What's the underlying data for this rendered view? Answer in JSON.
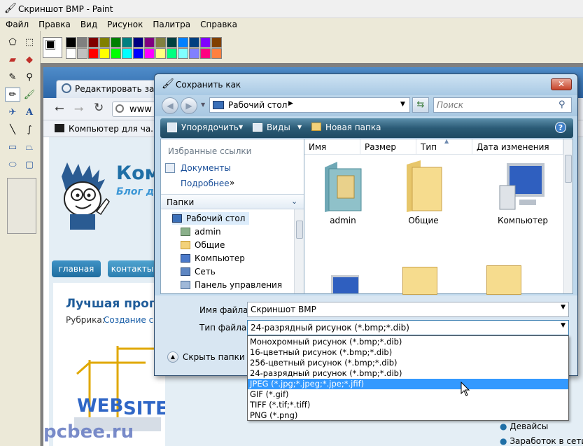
{
  "paint": {
    "title": "Скриншот BMP - Paint",
    "menu": [
      "Файл",
      "Правка",
      "Вид",
      "Рисунок",
      "Палитра",
      "Справка"
    ],
    "tools": [
      "free-select-icon",
      "rect-select-icon",
      "eraser-icon",
      "fill-bucket-icon",
      "color-picker-icon",
      "magnifier-icon",
      "pencil-icon",
      "brush-icon",
      "airbrush-icon",
      "text-icon",
      "line-icon",
      "curve-icon",
      "rectangle-icon",
      "polygon-icon",
      "ellipse-icon",
      "rounded-rect-icon"
    ],
    "palette_row1": [
      "#000000",
      "#808080",
      "#800000",
      "#808000",
      "#008000",
      "#008080",
      "#000080",
      "#800080",
      "#808040",
      "#004040",
      "#0080ff",
      "#004080",
      "#8000ff",
      "#804000"
    ],
    "palette_row2": [
      "#ffffff",
      "#c0c0c0",
      "#ff0000",
      "#ffff00",
      "#00ff00",
      "#00ffff",
      "#0000ff",
      "#ff00ff",
      "#ffff80",
      "#00ff80",
      "#80ffff",
      "#8080ff",
      "#ff0080",
      "#ff8040"
    ],
    "primary_color": "#000000",
    "secondary_color": "#ffffff"
  },
  "browser": {
    "tab_title": "Редактировать запис",
    "address": "www",
    "bookmark": "Компьютер для ча...",
    "site_title": "Ком",
    "site_subtitle": "Блог д",
    "nav_main": "главная",
    "nav_contacts": "контакты",
    "post_title": "Лучшая прогр",
    "rubric_label": "Рубрика:",
    "rubric_link": "Создание са",
    "sidebar_items": [
      "Девайсы",
      "Заработок в сети И"
    ],
    "watermark": "pcbee.ru"
  },
  "dialog": {
    "title": "Сохранить как",
    "location": "Рабочий стол",
    "search_placeholder": "Поиск",
    "cmd_organize": "Упорядочить",
    "cmd_views": "Виды",
    "cmd_new_folder": "Новая папка",
    "favorites_header": "Избранные ссылки",
    "favorites_documents": "Документы",
    "favorites_more": "Подробнее",
    "folders_header": "Папки",
    "tree": [
      "Рабочий стол",
      "admin",
      "Общие",
      "Компьютер",
      "Сеть",
      "Панель управления"
    ],
    "columns": [
      "Имя",
      "Размер",
      "Тип",
      "Дата изменения"
    ],
    "items": [
      "admin",
      "Общие",
      "Компьютер"
    ],
    "filename_label": "Имя файла:",
    "filename_value": "Скриншот BMP",
    "filetype_label": "Тип файла:",
    "filetype_value": "24-разрядный рисунок (*.bmp;*.dib)",
    "hide_folders": "Скрыть папки",
    "filetype_options": [
      "Монохромный рисунок (*.bmp;*.dib)",
      "16-цветный рисунок (*.bmp;*.dib)",
      "256-цветный рисунок (*.bmp;*.dib)",
      "24-разрядный рисунок (*.bmp;*.dib)",
      "JPEG (*.jpg;*.jpeg;*.jpe;*.jfif)",
      "GIF (*.gif)",
      "TIFF (*.tif;*.tiff)",
      "PNG (*.png)"
    ],
    "selected_option_index": 4
  },
  "colors": {
    "accent": "#3399ff",
    "cmdbar": "#2b5b76",
    "link": "#1a5fa8",
    "site_title": "#1f6fa6"
  }
}
